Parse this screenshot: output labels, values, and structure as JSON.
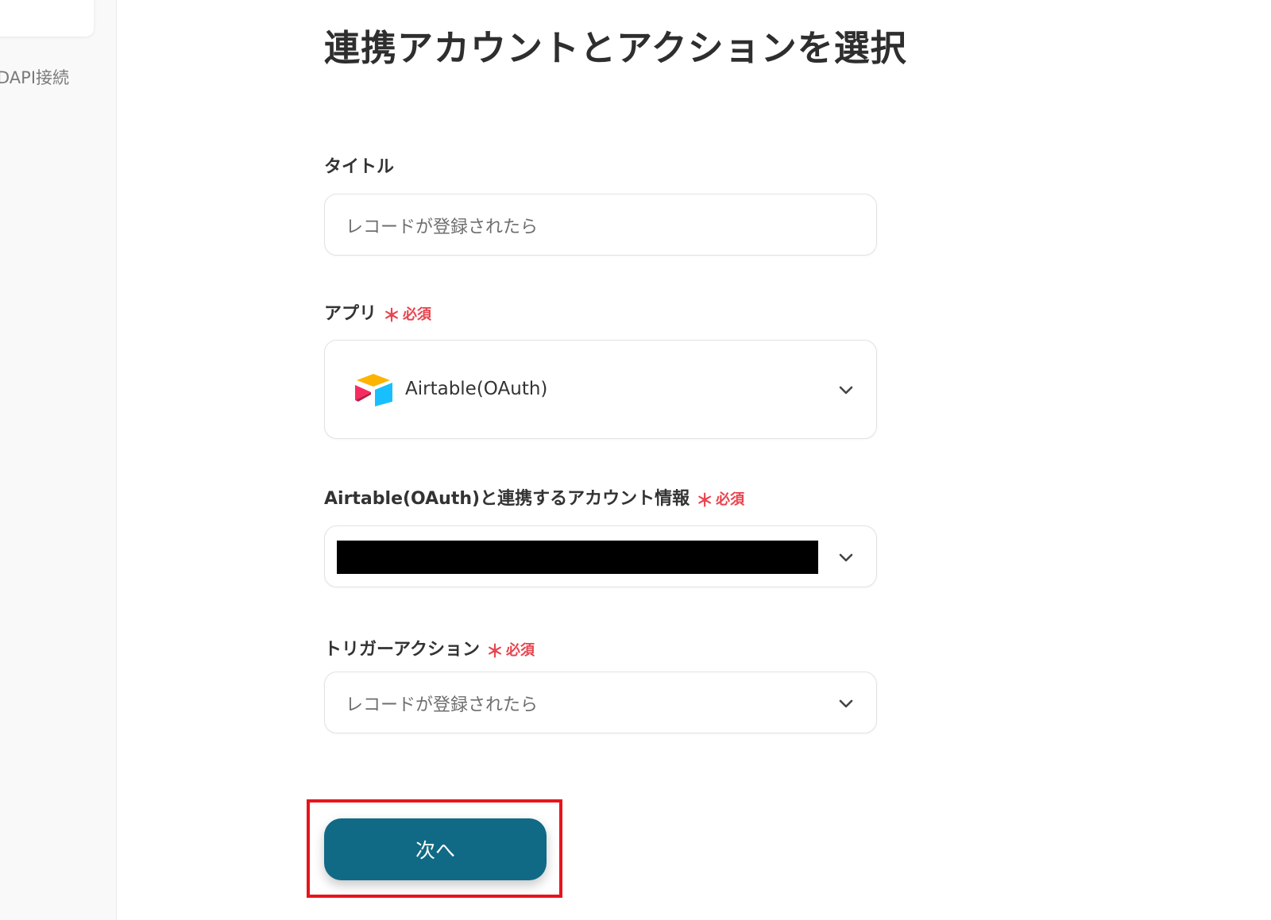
{
  "sidebar": {
    "link_label": "DAPI接続"
  },
  "page": {
    "title": "連携アカウントとアクションを選択"
  },
  "form": {
    "title_field": {
      "label": "タイトル",
      "value": "レコードが登録されたら"
    },
    "app_field": {
      "label": "アプリ",
      "required_label": "必須",
      "value": "Airtable(OAuth)",
      "icon": "airtable-logo-icon"
    },
    "account_field": {
      "label": "Airtable(OAuth)と連携するアカウント情報",
      "required_label": "必須",
      "value_redacted": true
    },
    "trigger_field": {
      "label": "トリガーアクション",
      "required_label": "必須",
      "value": "レコードが登録されたら"
    },
    "required_mark": "＊"
  },
  "actions": {
    "next_label": "次へ"
  },
  "colors": {
    "primary_button": "#106a85",
    "required": "#e8454f",
    "highlight": "#e8141c"
  }
}
